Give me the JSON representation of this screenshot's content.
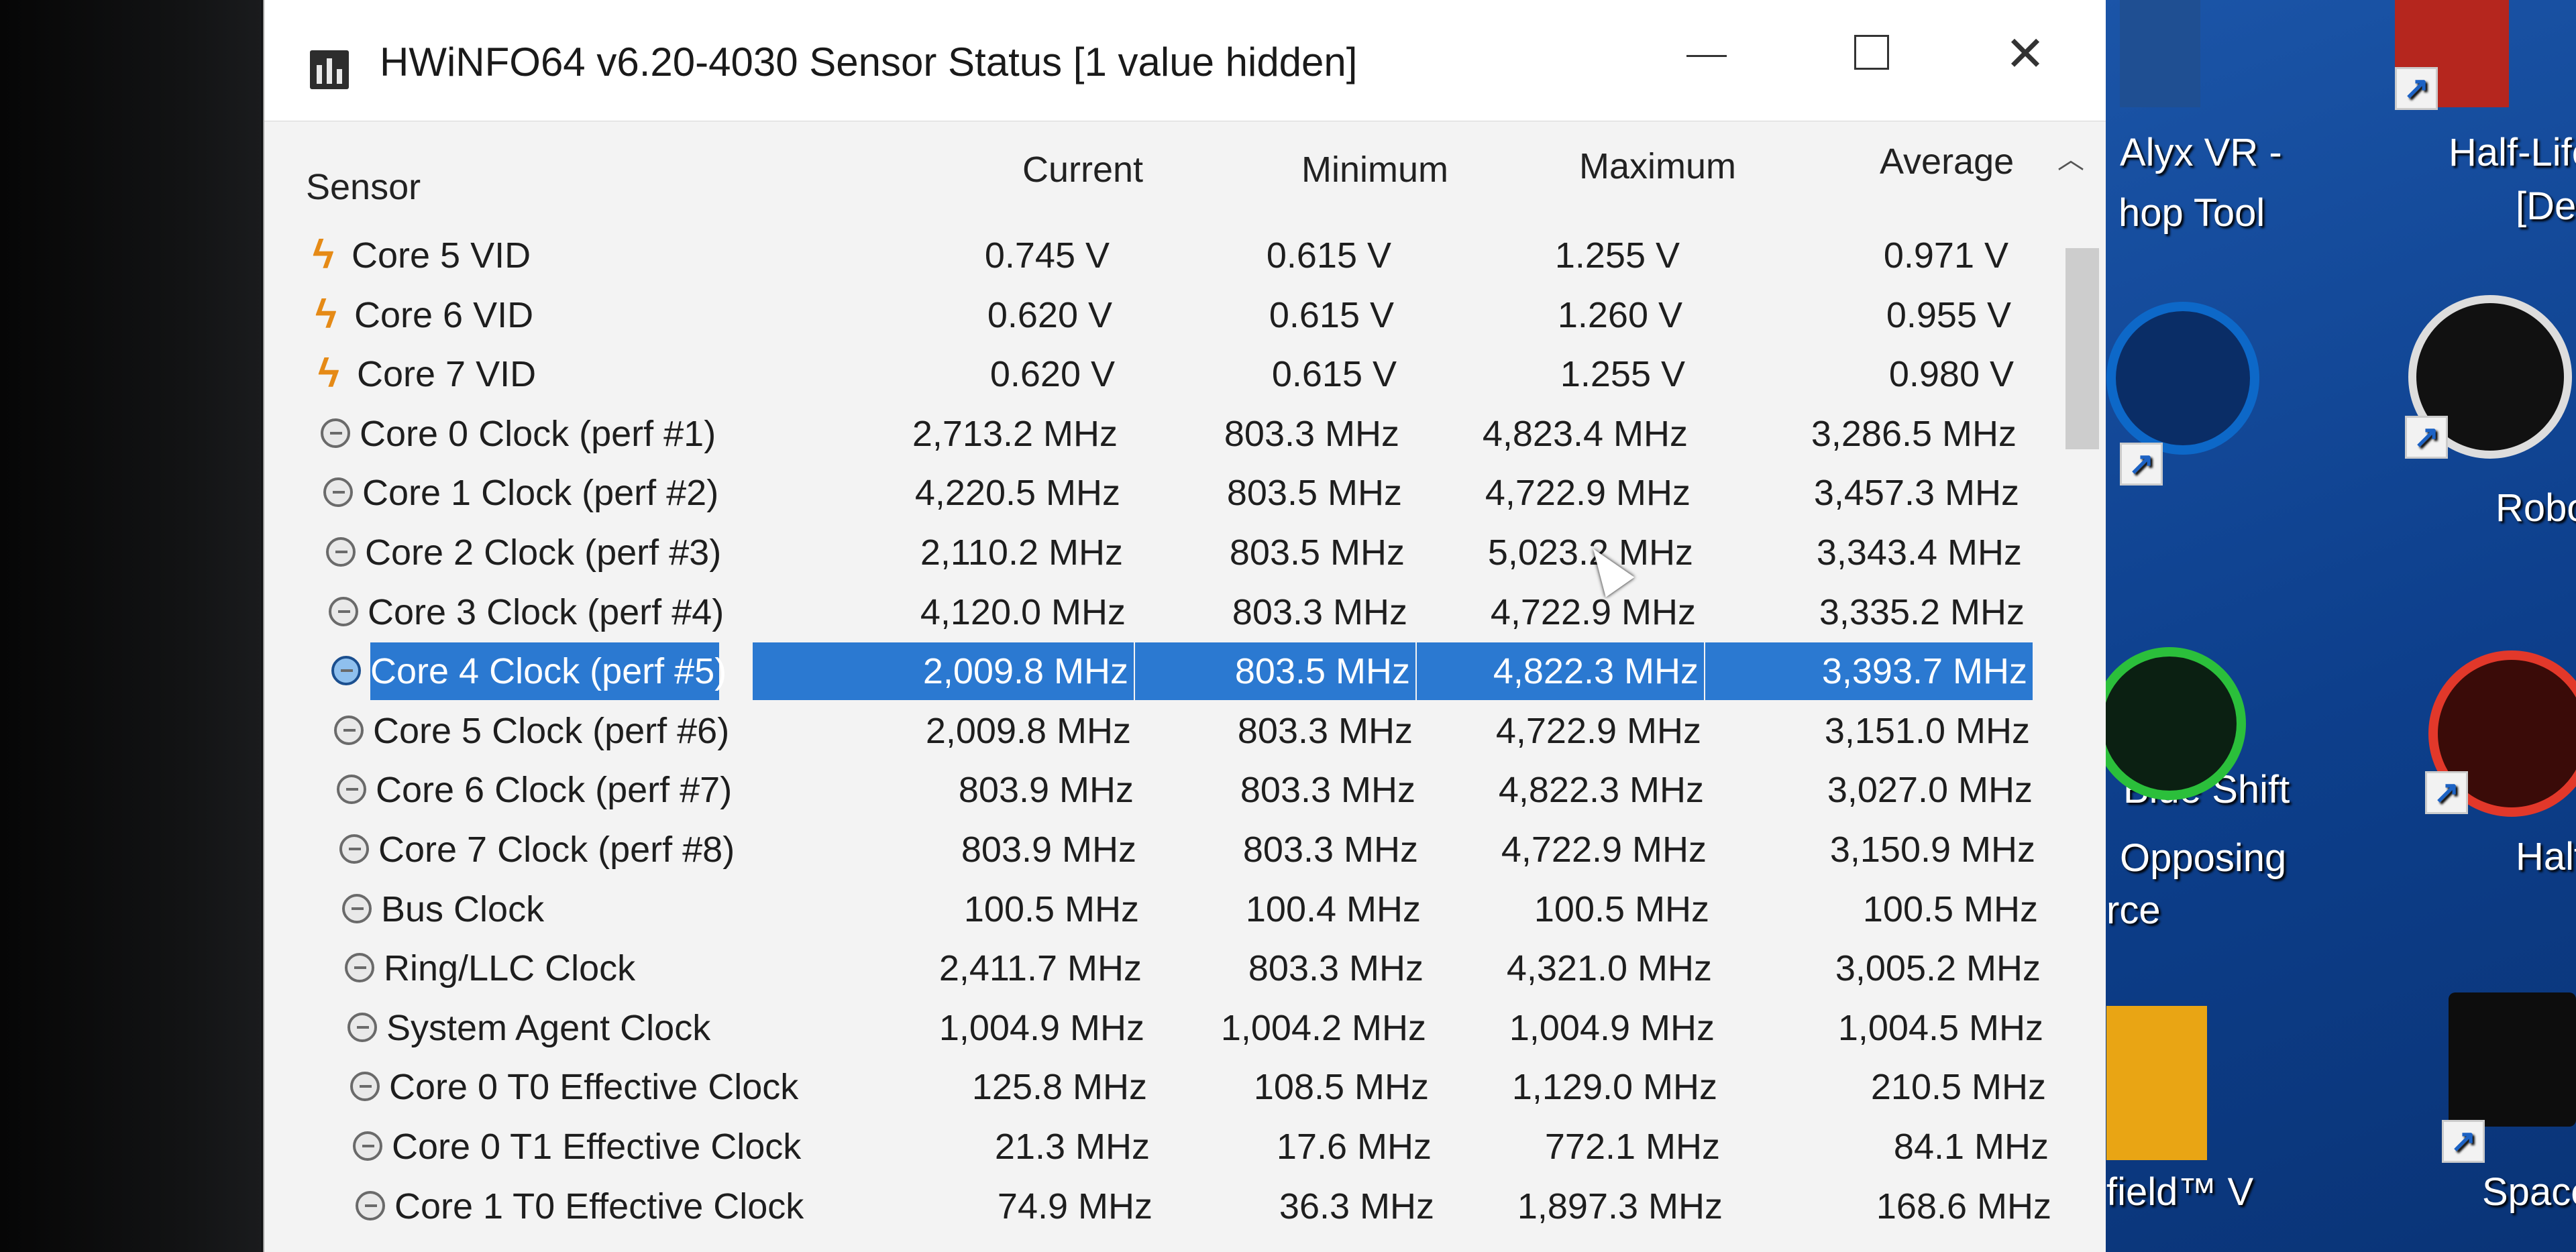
{
  "window": {
    "title": "HWiNFO64 v6.20-4030 Sensor Status [1 value hidden]",
    "close_glyph": "✕"
  },
  "columns": {
    "sensor": "Sensor",
    "current": "Current",
    "minimum": "Minimum",
    "maximum": "Maximum",
    "average": "Average"
  },
  "rows": [
    {
      "icon": "voltage-icon",
      "name": "Core 5 VID",
      "current": "0.745 V",
      "minimum": "0.615 V",
      "maximum": "1.255 V",
      "average": "0.971 V"
    },
    {
      "icon": "voltage-icon",
      "name": "Core 6 VID",
      "current": "0.620 V",
      "minimum": "0.615 V",
      "maximum": "1.260 V",
      "average": "0.955 V"
    },
    {
      "icon": "voltage-icon",
      "name": "Core 7 VID",
      "current": "0.620 V",
      "minimum": "0.615 V",
      "maximum": "1.255 V",
      "average": "0.980 V"
    },
    {
      "icon": "clock-icon",
      "name": "Core 0 Clock (perf #1)",
      "current": "2,713.2 MHz",
      "minimum": "803.3 MHz",
      "maximum": "4,823.4 MHz",
      "average": "3,286.5 MHz"
    },
    {
      "icon": "clock-icon",
      "name": "Core 1 Clock (perf #2)",
      "current": "4,220.5 MHz",
      "minimum": "803.5 MHz",
      "maximum": "4,722.9 MHz",
      "average": "3,457.3 MHz"
    },
    {
      "icon": "clock-icon",
      "name": "Core 2 Clock (perf #3)",
      "current": "2,110.2 MHz",
      "minimum": "803.5 MHz",
      "maximum": "5,023.2 MHz",
      "average": "3,343.4 MHz"
    },
    {
      "icon": "clock-icon",
      "name": "Core 3 Clock (perf #4)",
      "current": "4,120.0 MHz",
      "minimum": "803.3 MHz",
      "maximum": "4,722.9 MHz",
      "average": "3,335.2 MHz"
    },
    {
      "icon": "clock-icon",
      "name": "Core 4 Clock (perf #5)",
      "current": "2,009.8 MHz",
      "minimum": "803.5 MHz",
      "maximum": "4,822.3 MHz",
      "average": "3,393.7 MHz",
      "selected": true
    },
    {
      "icon": "clock-icon",
      "name": "Core 5 Clock (perf #6)",
      "current": "2,009.8 MHz",
      "minimum": "803.3 MHz",
      "maximum": "4,722.9 MHz",
      "average": "3,151.0 MHz"
    },
    {
      "icon": "clock-icon",
      "name": "Core 6 Clock (perf #7)",
      "current": "803.9 MHz",
      "minimum": "803.3 MHz",
      "maximum": "4,822.3 MHz",
      "average": "3,027.0 MHz"
    },
    {
      "icon": "clock-icon",
      "name": "Core 7 Clock (perf #8)",
      "current": "803.9 MHz",
      "minimum": "803.3 MHz",
      "maximum": "4,722.9 MHz",
      "average": "3,150.9 MHz"
    },
    {
      "icon": "clock-icon",
      "name": "Bus Clock",
      "current": "100.5 MHz",
      "minimum": "100.4 MHz",
      "maximum": "100.5 MHz",
      "average": "100.5 MHz"
    },
    {
      "icon": "clock-icon",
      "name": "Ring/LLC Clock",
      "current": "2,411.7 MHz",
      "minimum": "803.3 MHz",
      "maximum": "4,321.0 MHz",
      "average": "3,005.2 MHz"
    },
    {
      "icon": "clock-icon",
      "name": "System Agent Clock",
      "current": "1,004.9 MHz",
      "minimum": "1,004.2 MHz",
      "maximum": "1,004.9 MHz",
      "average": "1,004.5 MHz"
    },
    {
      "icon": "clock-icon",
      "name": "Core 0 T0 Effective Clock",
      "current": "125.8 MHz",
      "minimum": "108.5 MHz",
      "maximum": "1,129.0 MHz",
      "average": "210.5 MHz"
    },
    {
      "icon": "clock-icon",
      "name": "Core 0 T1 Effective Clock",
      "current": "21.3 MHz",
      "minimum": "17.6 MHz",
      "maximum": "772.1 MHz",
      "average": "84.1 MHz"
    },
    {
      "icon": "clock-icon",
      "name": "Core 1 T0 Effective Clock",
      "current": "74.9 MHz",
      "minimum": "36.3 MHz",
      "maximum": "1,897.3 MHz",
      "average": "168.6 MHz"
    }
  ],
  "desktop": {
    "shortcuts": [
      {
        "label_1": "Alyx VR -",
        "label_2": "hop Tool"
      },
      {
        "label_1": "Half-Life A",
        "label_2": "[Deuts"
      },
      {
        "label_1": "Blue Shift"
      },
      {
        "label_1": "Robo Re"
      },
      {
        "label_1": "Opposing",
        "label_2": "rce"
      },
      {
        "label_1": "Half-Li"
      },
      {
        "label_1": "field™ V"
      },
      {
        "label_1": "Space Pirate"
      }
    ]
  },
  "colors": {
    "selection": "#2b79d1",
    "voltage_icon": "#e58a16",
    "desktop": "#1b55a8"
  }
}
